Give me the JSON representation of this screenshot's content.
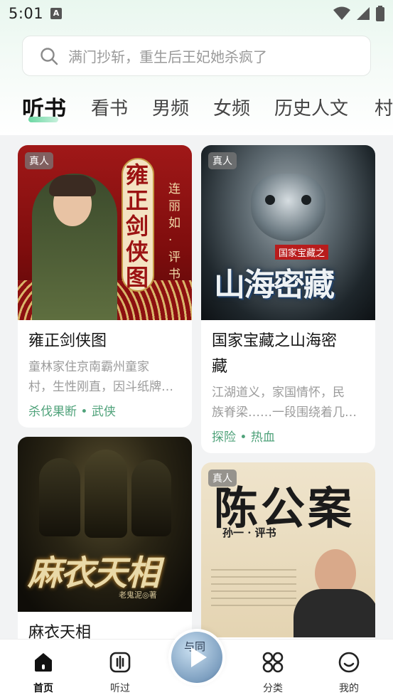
{
  "status": {
    "time": "5:01",
    "notif_icon": "A"
  },
  "search": {
    "placeholder": "满门抄斩，重生后王妃她杀疯了"
  },
  "tabs": [
    {
      "label": "听书",
      "active": true
    },
    {
      "label": "看书"
    },
    {
      "label": "男频"
    },
    {
      "label": "女频"
    },
    {
      "label": "历史人文"
    },
    {
      "label": "村"
    }
  ],
  "cards": [
    {
      "badge": "真人",
      "title": "雍正剑侠图",
      "desc_line1": "童林家住京南霸州童家",
      "desc_line2": "村，生性刚直，因斗纸牌…",
      "tags": "杀伐果断 • 武侠",
      "cover_big": "雍正剑侠图",
      "cover_small": "连丽如·评书"
    },
    {
      "badge": "真人",
      "title_line1": "国家宝藏之山海密",
      "title_line2": "藏",
      "desc_line1": "江湖道义，家国情怀，民",
      "desc_line2": "族脊梁……一段围绕着几…",
      "tags": "探险 • 热血",
      "cover_small": "国家宝藏之",
      "cover_big": "山海密藏"
    },
    {
      "title": "麻衣天相",
      "cover_big": "麻衣天相",
      "cover_small": "老鬼泥◎著"
    },
    {
      "badge": "真人",
      "cover_big": "陈公案",
      "cover_small": "孙一 · 评书"
    }
  ],
  "nav": {
    "home": "首页",
    "listened": "听过",
    "center_text": "与同",
    "category": "分类",
    "mine": "我的"
  },
  "colors": {
    "accent": "#4fa27a",
    "indicator": "#6ad7a2"
  }
}
